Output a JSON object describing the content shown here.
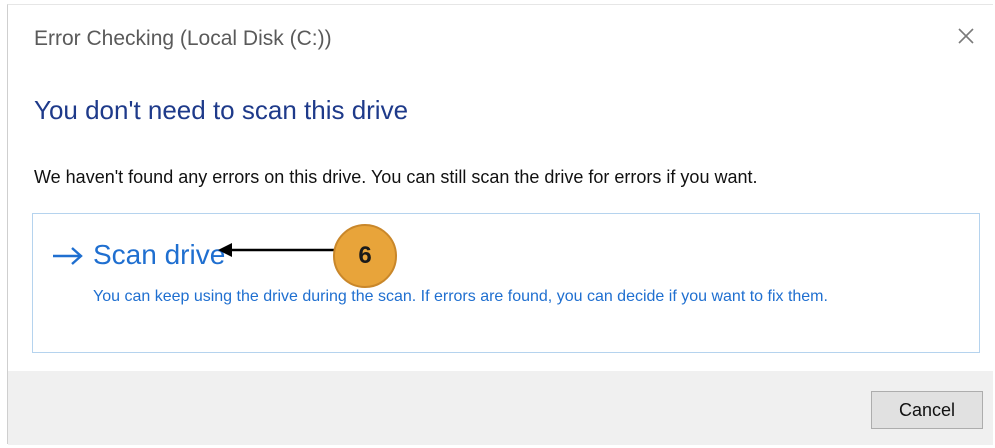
{
  "dialog": {
    "title": "Error Checking (Local Disk (C:))",
    "heading": "You don't need to scan this drive",
    "description": "We haven't found any errors on this drive. You can still scan the drive for errors if you want."
  },
  "scan_option": {
    "icon": "arrow-right-icon",
    "title": "Scan drive",
    "description": "You can keep using the drive during the scan. If errors are found, you can decide if you want to fix them."
  },
  "annotation": {
    "number": "6",
    "color": "#e8a43a"
  },
  "footer": {
    "cancel_label": "Cancel"
  },
  "colors": {
    "heading": "#1e3a8a",
    "link": "#1f6fd0",
    "panel_border": "#b5d3ee",
    "footer_bg": "#f0f0f0"
  }
}
